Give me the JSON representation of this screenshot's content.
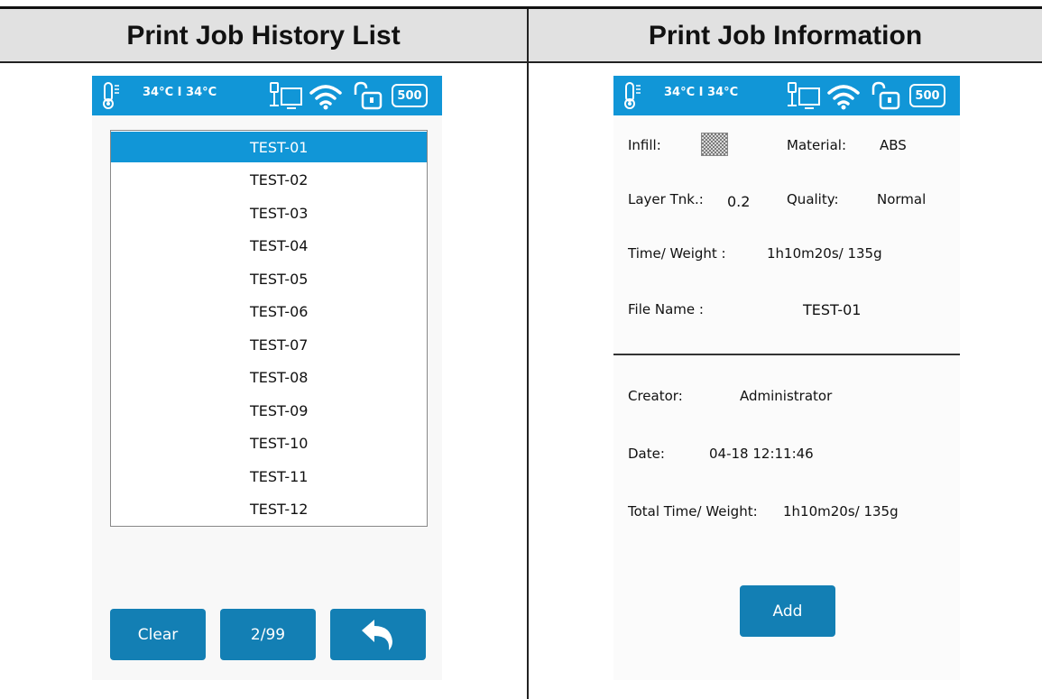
{
  "header": {
    "left_title": "Print Job History List",
    "right_title": "Print Job Information"
  },
  "status_bar": {
    "temperature": "34°C I 34°C",
    "icons": [
      "thermometer-icon",
      "usb-computer-icon",
      "wifi-icon",
      "unlock-icon",
      "filament-500-badge"
    ],
    "badge": "500",
    "color": "#1196d7"
  },
  "history_list": {
    "selected_index": 0,
    "items": [
      "TEST-01",
      "TEST-02",
      "TEST-03",
      "TEST-04",
      "TEST-05",
      "TEST-06",
      "TEST-07",
      "TEST-08",
      "TEST-09",
      "TEST-10",
      "TEST-11",
      "TEST-12"
    ],
    "buttons": {
      "clear": "Clear",
      "page": "2/99",
      "back_icon": "back-arrow-icon"
    }
  },
  "job_info": {
    "infill_label": "Infill:",
    "material_label": "Material:",
    "material_value": "ABS",
    "layer_label": "Layer Tnk.:",
    "layer_value": "0.2",
    "quality_label": "Quality:",
    "quality_value": "Normal",
    "time_weight_label": "Time/ Weight :",
    "time_weight_value": "1h10m20s/ 135g",
    "file_name_label": "File Name :",
    "file_name_value": "TEST-01",
    "creator_label": "Creator:",
    "creator_value": "Administrator",
    "date_label": "Date:",
    "date_value": "04-18 12:11:46",
    "total_label": "Total Time/ Weight:",
    "total_value": "1h10m20s/ 135g",
    "add_button": "Add"
  },
  "colors": {
    "accent": "#1196d7",
    "button": "#137fb4",
    "header_bg": "#e1e1e1"
  }
}
